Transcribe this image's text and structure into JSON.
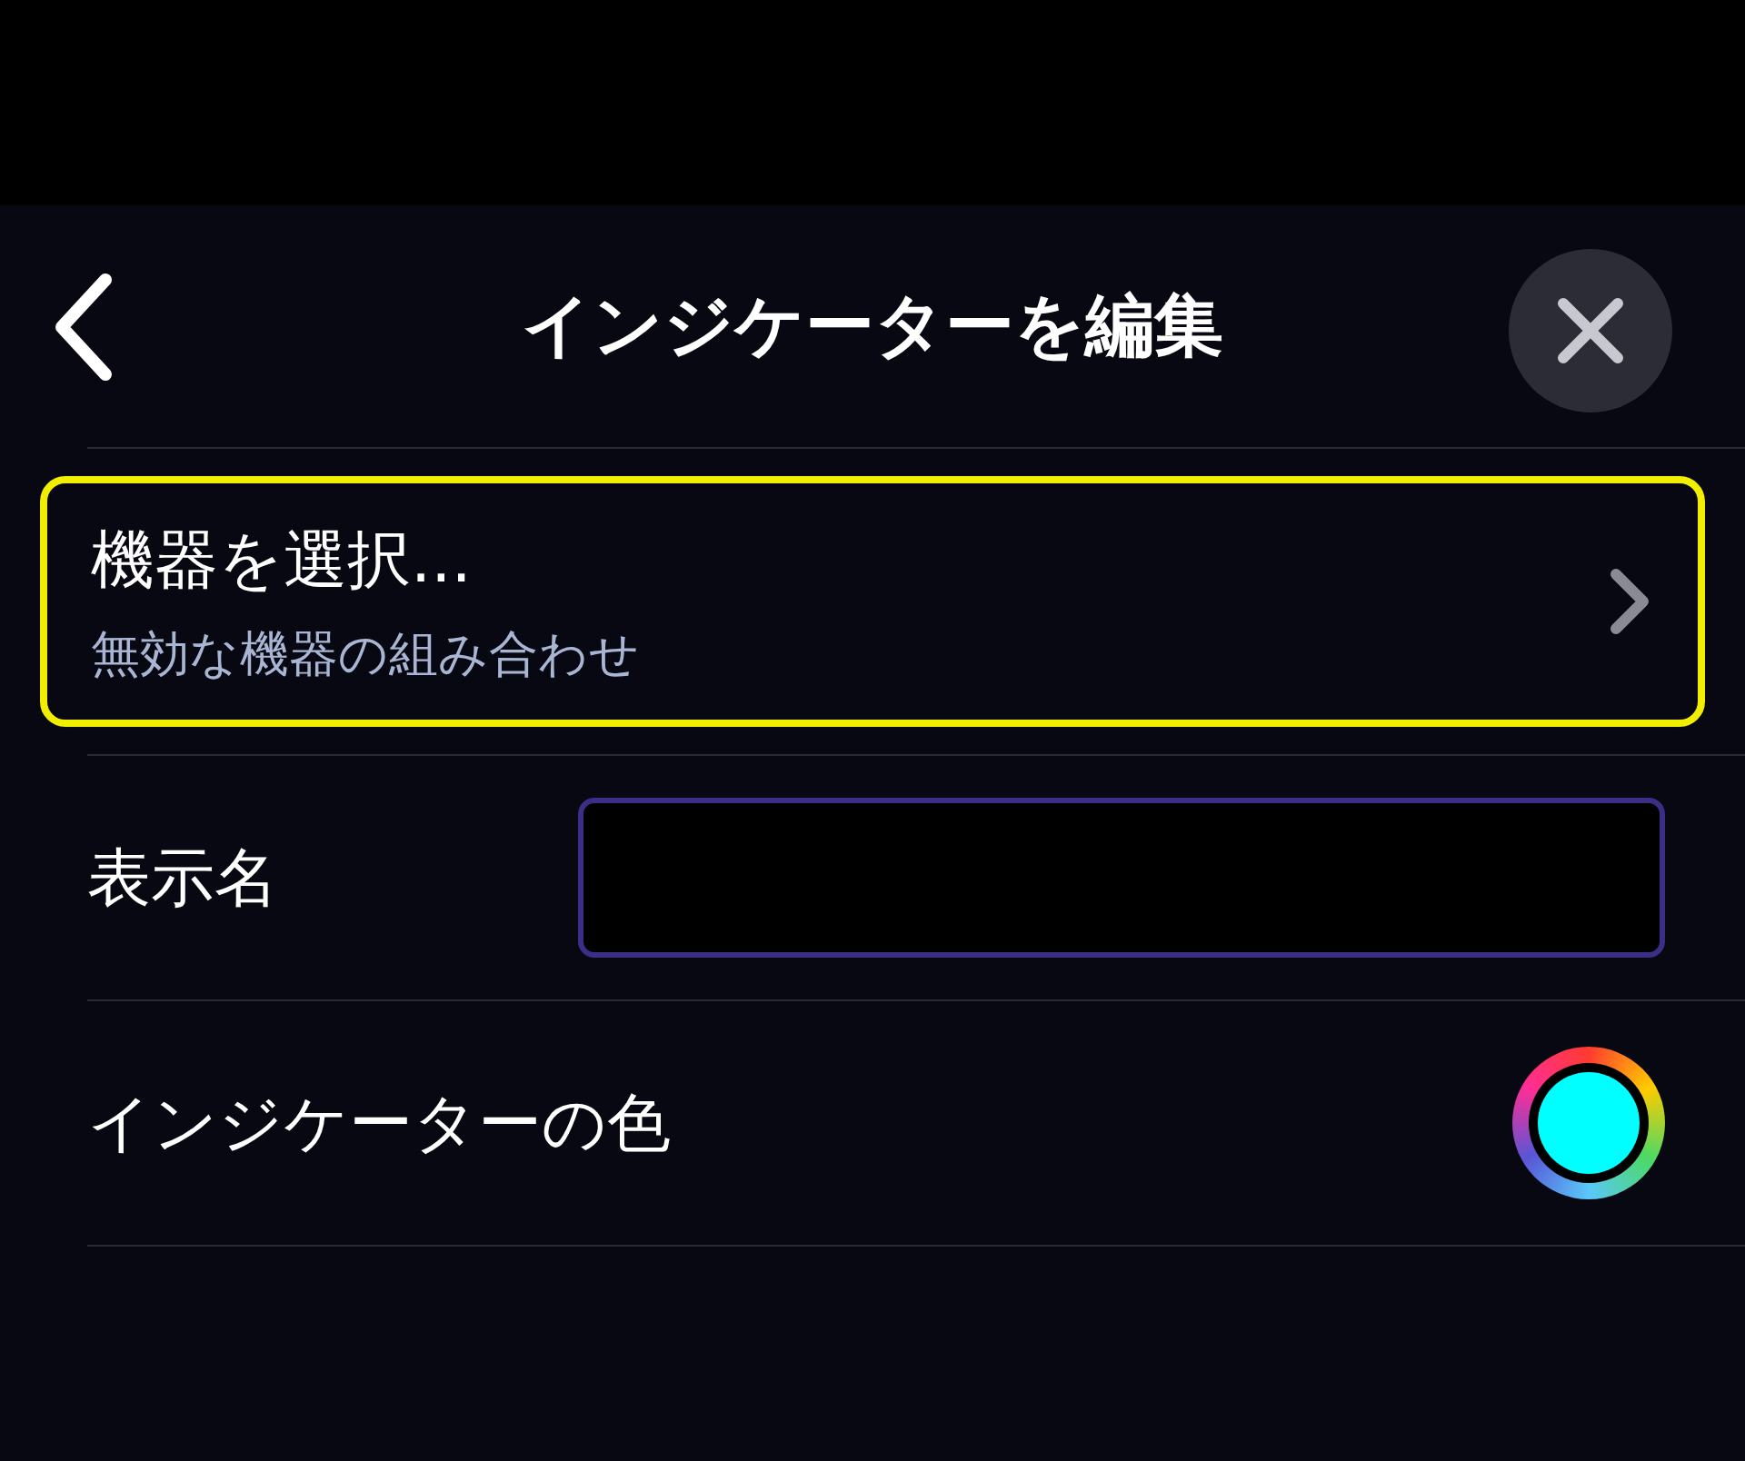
{
  "header": {
    "title": "インジケーターを編集"
  },
  "device_row": {
    "title": "機器を選択...",
    "subtitle": "無効な機器の組み合わせ",
    "highlighted": true
  },
  "name_row": {
    "label": "表示名"
  },
  "color_row": {
    "label": "インジケーターの色",
    "color": "#00ffff"
  }
}
